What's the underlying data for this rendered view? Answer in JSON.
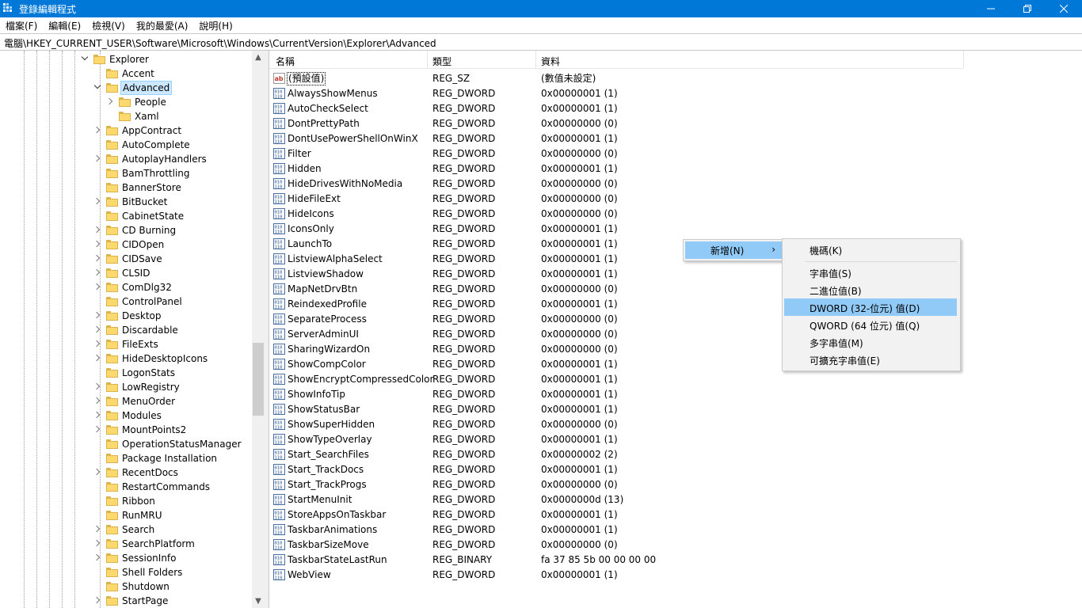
{
  "window": {
    "title": "登錄編輯程式"
  },
  "menu": [
    "檔案(F)",
    "編輯(E)",
    "檢視(V)",
    "我的最愛(A)",
    "說明(H)"
  ],
  "address": "電腦\\HKEY_CURRENT_USER\\Software\\Microsoft\\Windows\\CurrentVersion\\Explorer\\Advanced",
  "tree": {
    "nodes": [
      {
        "label": "Explorer",
        "level": 0,
        "expander": "open"
      },
      {
        "label": "Accent",
        "level": 1,
        "expander": "none"
      },
      {
        "label": "Advanced",
        "level": 1,
        "expander": "open",
        "selected": true
      },
      {
        "label": "People",
        "level": 2,
        "expander": "closed"
      },
      {
        "label": "Xaml",
        "level": 2,
        "expander": "none"
      },
      {
        "label": "AppContract",
        "level": 1,
        "expander": "closed"
      },
      {
        "label": "AutoComplete",
        "level": 1,
        "expander": "none"
      },
      {
        "label": "AutoplayHandlers",
        "level": 1,
        "expander": "closed"
      },
      {
        "label": "BamThrottling",
        "level": 1,
        "expander": "none"
      },
      {
        "label": "BannerStore",
        "level": 1,
        "expander": "none"
      },
      {
        "label": "BitBucket",
        "level": 1,
        "expander": "closed"
      },
      {
        "label": "CabinetState",
        "level": 1,
        "expander": "none"
      },
      {
        "label": "CD Burning",
        "level": 1,
        "expander": "closed"
      },
      {
        "label": "CIDOpen",
        "level": 1,
        "expander": "closed"
      },
      {
        "label": "CIDSave",
        "level": 1,
        "expander": "closed"
      },
      {
        "label": "CLSID",
        "level": 1,
        "expander": "closed"
      },
      {
        "label": "ComDlg32",
        "level": 1,
        "expander": "closed"
      },
      {
        "label": "ControlPanel",
        "level": 1,
        "expander": "none"
      },
      {
        "label": "Desktop",
        "level": 1,
        "expander": "closed"
      },
      {
        "label": "Discardable",
        "level": 1,
        "expander": "closed"
      },
      {
        "label": "FileExts",
        "level": 1,
        "expander": "closed"
      },
      {
        "label": "HideDesktopIcons",
        "level": 1,
        "expander": "closed"
      },
      {
        "label": "LogonStats",
        "level": 1,
        "expander": "none"
      },
      {
        "label": "LowRegistry",
        "level": 1,
        "expander": "closed"
      },
      {
        "label": "MenuOrder",
        "level": 1,
        "expander": "closed"
      },
      {
        "label": "Modules",
        "level": 1,
        "expander": "closed"
      },
      {
        "label": "MountPoints2",
        "level": 1,
        "expander": "closed"
      },
      {
        "label": "OperationStatusManager",
        "level": 1,
        "expander": "none"
      },
      {
        "label": "Package Installation",
        "level": 1,
        "expander": "none"
      },
      {
        "label": "RecentDocs",
        "level": 1,
        "expander": "closed"
      },
      {
        "label": "RestartCommands",
        "level": 1,
        "expander": "none"
      },
      {
        "label": "Ribbon",
        "level": 1,
        "expander": "none"
      },
      {
        "label": "RunMRU",
        "level": 1,
        "expander": "none"
      },
      {
        "label": "Search",
        "level": 1,
        "expander": "closed"
      },
      {
        "label": "SearchPlatform",
        "level": 1,
        "expander": "closed"
      },
      {
        "label": "SessionInfo",
        "level": 1,
        "expander": "closed"
      },
      {
        "label": "Shell Folders",
        "level": 1,
        "expander": "none"
      },
      {
        "label": "Shutdown",
        "level": 1,
        "expander": "none"
      },
      {
        "label": "StartPage",
        "level": 1,
        "expander": "closed"
      }
    ]
  },
  "list": {
    "columns": [
      "名稱",
      "類型",
      "資料"
    ],
    "rows": [
      {
        "name": "(預設值)",
        "type": "REG_SZ",
        "data": "(數值未設定)",
        "icon": "string-value-icon"
      },
      {
        "name": "AlwaysShowMenus",
        "type": "REG_DWORD",
        "data": "0x00000001 (1)",
        "icon": "binary-value-icon"
      },
      {
        "name": "AutoCheckSelect",
        "type": "REG_DWORD",
        "data": "0x00000001 (1)",
        "icon": "binary-value-icon"
      },
      {
        "name": "DontPrettyPath",
        "type": "REG_DWORD",
        "data": "0x00000000 (0)",
        "icon": "binary-value-icon"
      },
      {
        "name": "DontUsePowerShellOnWinX",
        "type": "REG_DWORD",
        "data": "0x00000001 (1)",
        "icon": "binary-value-icon"
      },
      {
        "name": "Filter",
        "type": "REG_DWORD",
        "data": "0x00000000 (0)",
        "icon": "binary-value-icon"
      },
      {
        "name": "Hidden",
        "type": "REG_DWORD",
        "data": "0x00000001 (1)",
        "icon": "binary-value-icon"
      },
      {
        "name": "HideDrivesWithNoMedia",
        "type": "REG_DWORD",
        "data": "0x00000000 (0)",
        "icon": "binary-value-icon"
      },
      {
        "name": "HideFileExt",
        "type": "REG_DWORD",
        "data": "0x00000000 (0)",
        "icon": "binary-value-icon"
      },
      {
        "name": "HideIcons",
        "type": "REG_DWORD",
        "data": "0x00000000 (0)",
        "icon": "binary-value-icon"
      },
      {
        "name": "IconsOnly",
        "type": "REG_DWORD",
        "data": "0x00000001 (1)",
        "icon": "binary-value-icon"
      },
      {
        "name": "LaunchTo",
        "type": "REG_DWORD",
        "data": "0x00000001 (1)",
        "icon": "binary-value-icon"
      },
      {
        "name": "ListviewAlphaSelect",
        "type": "REG_DWORD",
        "data": "0x00000001 (1)",
        "icon": "binary-value-icon"
      },
      {
        "name": "ListviewShadow",
        "type": "REG_DWORD",
        "data": "0x00000001 (1)",
        "icon": "binary-value-icon"
      },
      {
        "name": "MapNetDrvBtn",
        "type": "REG_DWORD",
        "data": "0x00000000 (0)",
        "icon": "binary-value-icon"
      },
      {
        "name": "ReindexedProfile",
        "type": "REG_DWORD",
        "data": "0x00000001 (1)",
        "icon": "binary-value-icon"
      },
      {
        "name": "SeparateProcess",
        "type": "REG_DWORD",
        "data": "0x00000000 (0)",
        "icon": "binary-value-icon"
      },
      {
        "name": "ServerAdminUI",
        "type": "REG_DWORD",
        "data": "0x00000000 (0)",
        "icon": "binary-value-icon"
      },
      {
        "name": "SharingWizardOn",
        "type": "REG_DWORD",
        "data": "0x00000000 (0)",
        "icon": "binary-value-icon"
      },
      {
        "name": "ShowCompColor",
        "type": "REG_DWORD",
        "data": "0x00000001 (1)",
        "icon": "binary-value-icon"
      },
      {
        "name": "ShowEncryptCompressedColor",
        "type": "REG_DWORD",
        "data": "0x00000001 (1)",
        "icon": "binary-value-icon"
      },
      {
        "name": "ShowInfoTip",
        "type": "REG_DWORD",
        "data": "0x00000001 (1)",
        "icon": "binary-value-icon"
      },
      {
        "name": "ShowStatusBar",
        "type": "REG_DWORD",
        "data": "0x00000001 (1)",
        "icon": "binary-value-icon"
      },
      {
        "name": "ShowSuperHidden",
        "type": "REG_DWORD",
        "data": "0x00000000 (0)",
        "icon": "binary-value-icon"
      },
      {
        "name": "ShowTypeOverlay",
        "type": "REG_DWORD",
        "data": "0x00000001 (1)",
        "icon": "binary-value-icon"
      },
      {
        "name": "Start_SearchFiles",
        "type": "REG_DWORD",
        "data": "0x00000002 (2)",
        "icon": "binary-value-icon"
      },
      {
        "name": "Start_TrackDocs",
        "type": "REG_DWORD",
        "data": "0x00000001 (1)",
        "icon": "binary-value-icon"
      },
      {
        "name": "Start_TrackProgs",
        "type": "REG_DWORD",
        "data": "0x00000000 (0)",
        "icon": "binary-value-icon"
      },
      {
        "name": "StartMenuInit",
        "type": "REG_DWORD",
        "data": "0x0000000d (13)",
        "icon": "binary-value-icon"
      },
      {
        "name": "StoreAppsOnTaskbar",
        "type": "REG_DWORD",
        "data": "0x00000001 (1)",
        "icon": "binary-value-icon"
      },
      {
        "name": "TaskbarAnimations",
        "type": "REG_DWORD",
        "data": "0x00000001 (1)",
        "icon": "binary-value-icon"
      },
      {
        "name": "TaskbarSizeMove",
        "type": "REG_DWORD",
        "data": "0x00000000 (0)",
        "icon": "binary-value-icon"
      },
      {
        "name": "TaskbarStateLastRun",
        "type": "REG_BINARY",
        "data": "fa 37 85 5b 00 00 00 00",
        "icon": "binary-value-icon"
      },
      {
        "name": "WebView",
        "type": "REG_DWORD",
        "data": "0x00000001 (1)",
        "icon": "binary-value-icon"
      }
    ]
  },
  "context_menu": {
    "new_label": "新增(N)",
    "new_arrow": "›",
    "submenu": [
      {
        "label": "機碼(K)"
      },
      {
        "label": "字串值(S)"
      },
      {
        "label": "二進位值(B)"
      },
      {
        "label": "DWORD (32-位元) 值(D)",
        "highlighted": true
      },
      {
        "label": "QWORD (64 位元) 值(Q)"
      },
      {
        "label": "多字串值(M)"
      },
      {
        "label": "可擴充字串值(E)"
      }
    ]
  },
  "colors": {
    "titlebar": "#0078d7",
    "selection": "#cce8ff",
    "menu_highlight": "#91c9f7",
    "folder": "#fcd96f"
  }
}
